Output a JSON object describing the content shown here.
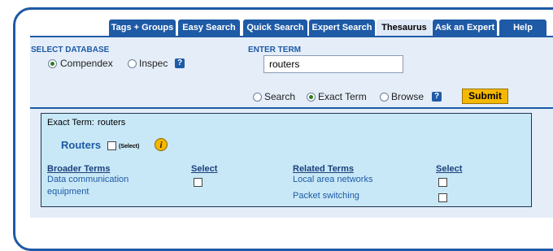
{
  "tabs": [
    {
      "label": "Tags + Groups",
      "active": false
    },
    {
      "label": "Easy Search",
      "active": false
    },
    {
      "label": "Quick Search",
      "active": false
    },
    {
      "label": "Expert Search",
      "active": false
    },
    {
      "label": "Thesaurus",
      "active": true
    },
    {
      "label": "Ask an Expert",
      "active": false
    },
    {
      "label": "Help",
      "active": false
    }
  ],
  "database": {
    "label": "SELECT DATABASE",
    "options": [
      {
        "label": "Compendex",
        "checked": true
      },
      {
        "label": "Inspec",
        "checked": false
      }
    ],
    "help_icon": "?"
  },
  "term": {
    "label": "ENTER TERM",
    "value": "routers"
  },
  "mode": {
    "options": [
      {
        "label": "Search",
        "checked": false
      },
      {
        "label": "Exact Term",
        "checked": true
      },
      {
        "label": "Browse",
        "checked": false
      }
    ],
    "help_icon": "?"
  },
  "submit_label": "Submit",
  "results": {
    "exact_term_label": "Exact Term:",
    "exact_term_value": "routers",
    "main_term": "Routers",
    "select_text": "(Select)",
    "info_icon": "i",
    "broader": {
      "header": "Broader Terms",
      "select_header": "Select",
      "items": [
        "Data communication equipment"
      ]
    },
    "related": {
      "header": "Related Terms",
      "select_header": "Select",
      "items": [
        "Local area networks",
        "Packet switching"
      ]
    }
  },
  "colors": {
    "brand_blue": "#1e5aa6",
    "panel_bg": "#e4edf8",
    "results_bg": "#c9e8f7",
    "submit_yellow": "#f5b800",
    "active_tab": "#dfe9f7"
  },
  "icons": {
    "help": "help-icon",
    "info": "info-icon",
    "radio": "radio-button",
    "checkbox": "checkbox"
  }
}
